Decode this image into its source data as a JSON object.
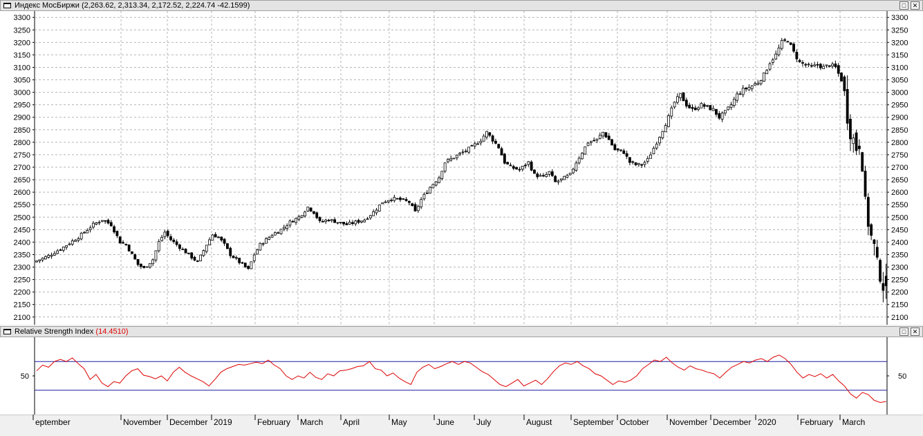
{
  "price_pane": {
    "title": "Индекс МосБиржи (2,263.62, 2,313.34, 2,172.52, 2,224.74 -42.1599)"
  },
  "rsi_pane": {
    "title": "Relative Strength Index",
    "value": "(14.4510)"
  },
  "colors": {
    "grid": "#b4b4b4",
    "candle": "#000000",
    "rsi_line": "#dd0000",
    "rsi_levels": "#1a1aa0",
    "title_value": "#e00000"
  },
  "chart_data": [
    {
      "type": "candlestick",
      "title": "Индекс МосБиржи (2,263.62, 2,313.34, 2,172.52, 2,224.74 -42.1599)",
      "ylim": [
        2080,
        3320
      ],
      "yticks": [
        2100,
        2150,
        2200,
        2250,
        2300,
        2350,
        2400,
        2450,
        2500,
        2550,
        2600,
        2650,
        2700,
        2750,
        2800,
        2850,
        2900,
        2950,
        3000,
        3050,
        3100,
        3150,
        3200,
        3250,
        3300
      ],
      "grid": true,
      "last_bar": {
        "open": 2263.62,
        "high": 2313.34,
        "low": 2172.52,
        "close": 2224.74,
        "change": -42.1599
      },
      "close_path": [
        [
          0,
          2320
        ],
        [
          5,
          2345
        ],
        [
          10,
          2380
        ],
        [
          15,
          2420
        ],
        [
          20,
          2470
        ],
        [
          23,
          2490
        ],
        [
          26,
          2470
        ],
        [
          29,
          2400
        ],
        [
          31,
          2390
        ],
        [
          33,
          2350
        ],
        [
          35,
          2310
        ],
        [
          37,
          2295
        ],
        [
          40,
          2330
        ],
        [
          42,
          2400
        ],
        [
          44,
          2440
        ],
        [
          46,
          2410
        ],
        [
          49,
          2380
        ],
        [
          52,
          2350
        ],
        [
          55,
          2320
        ],
        [
          58,
          2390
        ],
        [
          60,
          2430
        ],
        [
          62,
          2420
        ],
        [
          64,
          2390
        ],
        [
          66,
          2350
        ],
        [
          68,
          2330
        ],
        [
          70,
          2310
        ],
        [
          72,
          2290
        ],
        [
          74,
          2350
        ],
        [
          76,
          2390
        ],
        [
          78,
          2410
        ],
        [
          80,
          2430
        ],
        [
          83,
          2450
        ],
        [
          86,
          2480
        ],
        [
          89,
          2500
        ],
        [
          92,
          2540
        ],
        [
          94,
          2520
        ],
        [
          96,
          2480
        ],
        [
          99,
          2490
        ],
        [
          102,
          2480
        ],
        [
          105,
          2470
        ],
        [
          108,
          2480
        ],
        [
          111,
          2490
        ],
        [
          114,
          2520
        ],
        [
          117,
          2560
        ],
        [
          120,
          2575
        ],
        [
          123,
          2570
        ],
        [
          126,
          2560
        ],
        [
          128,
          2520
        ],
        [
          130,
          2570
        ],
        [
          133,
          2620
        ],
        [
          136,
          2660
        ],
        [
          138,
          2720
        ],
        [
          141,
          2740
        ],
        [
          144,
          2760
        ],
        [
          147,
          2780
        ],
        [
          150,
          2810
        ],
        [
          152,
          2840
        ],
        [
          154,
          2810
        ],
        [
          156,
          2780
        ],
        [
          158,
          2720
        ],
        [
          160,
          2700
        ],
        [
          163,
          2690
        ],
        [
          166,
          2720
        ],
        [
          168,
          2670
        ],
        [
          171,
          2660
        ],
        [
          173,
          2680
        ],
        [
          175,
          2640
        ],
        [
          177,
          2650
        ],
        [
          180,
          2670
        ],
        [
          182,
          2720
        ],
        [
          184,
          2760
        ],
        [
          186,
          2800
        ],
        [
          189,
          2810
        ],
        [
          191,
          2840
        ],
        [
          193,
          2810
        ],
        [
          195,
          2770
        ],
        [
          198,
          2760
        ],
        [
          200,
          2720
        ],
        [
          202,
          2710
        ],
        [
          204,
          2710
        ],
        [
          206,
          2730
        ],
        [
          209,
          2800
        ],
        [
          211,
          2850
        ],
        [
          213,
          2900
        ],
        [
          215,
          2960
        ],
        [
          217,
          2990
        ],
        [
          219,
          2950
        ],
        [
          221,
          2930
        ],
        [
          224,
          2950
        ],
        [
          226,
          2940
        ],
        [
          228,
          2930
        ],
        [
          230,
          2900
        ],
        [
          232,
          2920
        ],
        [
          234,
          2950
        ],
        [
          236,
          2990
        ],
        [
          238,
          3010
        ],
        [
          240,
          3020
        ],
        [
          243,
          3040
        ],
        [
          245,
          3070
        ],
        [
          247,
          3120
        ],
        [
          249,
          3150
        ],
        [
          251,
          3200
        ],
        [
          253,
          3210
        ],
        [
          255,
          3160
        ],
        [
          257,
          3120
        ],
        [
          259,
          3110
        ],
        [
          261,
          3100
        ],
        [
          263,
          3110
        ],
        [
          265,
          3100
        ],
        [
          267,
          3110
        ],
        [
          269,
          3100
        ],
        [
          271,
          3050
        ],
        [
          272,
          2990
        ],
        [
          273,
          2910
        ],
        [
          274,
          2850
        ],
        [
          275,
          2810
        ],
        [
          276,
          2780
        ],
        [
          277,
          2800
        ],
        [
          278,
          2720
        ],
        [
          279,
          2550
        ],
        [
          280,
          2480
        ],
        [
          281,
          2420
        ],
        [
          282,
          2380
        ],
        [
          283,
          2310
        ],
        [
          284,
          2270
        ],
        [
          285,
          2225
        ]
      ]
    },
    {
      "type": "line",
      "title": "Relative Strength Index",
      "current_value": 14.451,
      "ylim": [
        0,
        100
      ],
      "yticks": [
        50
      ],
      "levels": [
        70,
        30
      ],
      "series": [
        {
          "values": [
            [
              0,
              57
            ],
            [
              3,
              65
            ],
            [
              6,
              62
            ],
            [
              9,
              70
            ],
            [
              12,
              73
            ],
            [
              15,
              70
            ],
            [
              18,
              75
            ],
            [
              21,
              67
            ],
            [
              24,
              60
            ],
            [
              27,
              45
            ],
            [
              30,
              52
            ],
            [
              33,
              40
            ],
            [
              36,
              35
            ],
            [
              39,
              42
            ],
            [
              42,
              40
            ],
            [
              45,
              50
            ],
            [
              48,
              57
            ],
            [
              51,
              60
            ],
            [
              54,
              51
            ],
            [
              57,
              49
            ],
            [
              60,
              46
            ],
            [
              63,
              50
            ],
            [
              66,
              43
            ],
            [
              69,
              55
            ],
            [
              72,
              62
            ],
            [
              75,
              55
            ],
            [
              78,
              50
            ],
            [
              81,
              46
            ],
            [
              84,
              42
            ],
            [
              87,
              36
            ],
            [
              90,
              45
            ],
            [
              93,
              55
            ],
            [
              96,
              60
            ],
            [
              99,
              63
            ],
            [
              102,
              66
            ],
            [
              105,
              65
            ],
            [
              108,
              67
            ],
            [
              111,
              69
            ],
            [
              114,
              67
            ],
            [
              117,
              72
            ],
            [
              120,
              65
            ],
            [
              123,
              60
            ],
            [
              126,
              50
            ],
            [
              129,
              45
            ],
            [
              132,
              50
            ],
            [
              135,
              47
            ],
            [
              138,
              55
            ],
            [
              141,
              48
            ],
            [
              144,
              45
            ],
            [
              147,
              53
            ],
            [
              150,
              50
            ],
            [
              153,
              57
            ],
            [
              156,
              58
            ],
            [
              159,
              60
            ],
            [
              162,
              63
            ],
            [
              165,
              64
            ],
            [
              168,
              70
            ],
            [
              171,
              60
            ],
            [
              174,
              58
            ],
            [
              177,
              50
            ],
            [
              180,
              54
            ],
            [
              183,
              47
            ],
            [
              186,
              42
            ],
            [
              189,
              38
            ],
            [
              192,
              55
            ],
            [
              195,
              62
            ],
            [
              198,
              66
            ],
            [
              201,
              60
            ],
            [
              204,
              63
            ],
            [
              207,
              67
            ],
            [
              210,
              70
            ],
            [
              213,
              66
            ],
            [
              216,
              70
            ],
            [
              219,
              68
            ],
            [
              222,
              62
            ],
            [
              225,
              56
            ],
            [
              228,
              52
            ],
            [
              231,
              45
            ],
            [
              234,
              38
            ],
            [
              237,
              35
            ],
            [
              240,
              40
            ],
            [
              243,
              45
            ],
            [
              246,
              36
            ],
            [
              249,
              40
            ],
            [
              252,
              44
            ],
            [
              255,
              38
            ],
            [
              258,
              46
            ],
            [
              261,
              56
            ],
            [
              264,
              64
            ],
            [
              267,
              68
            ],
            [
              270,
              66
            ],
            [
              273,
              70
            ],
            [
              276,
              64
            ],
            [
              279,
              60
            ],
            [
              282,
              53
            ],
            [
              285,
              50
            ],
            [
              288,
              44
            ],
            [
              291,
              38
            ],
            [
              294,
              43
            ],
            [
              297,
              41
            ],
            [
              300,
              44
            ],
            [
              303,
              50
            ],
            [
              306,
              60
            ],
            [
              309,
              66
            ],
            [
              312,
              72
            ],
            [
              315,
              70
            ],
            [
              318,
              76
            ],
            [
              321,
              68
            ],
            [
              324,
              62
            ],
            [
              327,
              58
            ],
            [
              330,
              64
            ],
            [
              333,
              60
            ],
            [
              336,
              58
            ],
            [
              339,
              55
            ],
            [
              342,
              53
            ],
            [
              345,
              47
            ],
            [
              348,
              55
            ],
            [
              351,
              62
            ],
            [
              354,
              66
            ],
            [
              357,
              70
            ],
            [
              360,
              68
            ],
            [
              363,
              72
            ],
            [
              366,
              74
            ],
            [
              369,
              70
            ],
            [
              372,
              76
            ],
            [
              375,
              79
            ],
            [
              378,
              74
            ],
            [
              381,
              66
            ],
            [
              384,
              55
            ],
            [
              387,
              47
            ],
            [
              390,
              52
            ],
            [
              393,
              49
            ],
            [
              396,
              53
            ],
            [
              399,
              47
            ],
            [
              402,
              52
            ],
            [
              405,
              43
            ],
            [
              408,
              36
            ],
            [
              411,
              25
            ],
            [
              414,
              19
            ],
            [
              417,
              27
            ],
            [
              420,
              24
            ],
            [
              423,
              16
            ],
            [
              426,
              13
            ],
            [
              429,
              14.451
            ]
          ]
        }
      ]
    }
  ],
  "x_axis": {
    "labels": [
      "eptember",
      "November",
      "December",
      "2019",
      "February",
      "March",
      "April",
      "May",
      "June",
      "July",
      "August",
      "September",
      "October",
      "November",
      "December",
      "2020",
      "February",
      "March"
    ]
  }
}
